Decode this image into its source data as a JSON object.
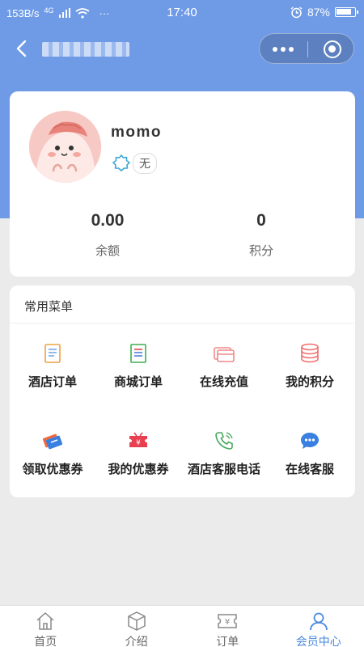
{
  "status_bar": {
    "speed": "153B/s",
    "network": "4G",
    "more": "···",
    "time": "17:40",
    "battery": "87%"
  },
  "profile": {
    "username": "momo",
    "level": "无"
  },
  "stats": [
    {
      "value": "0.00",
      "label": "余额"
    },
    {
      "value": "0",
      "label": "积分"
    }
  ],
  "menu": {
    "title": "常用菜单",
    "items": [
      {
        "label": "酒店订单",
        "icon": "document-icon"
      },
      {
        "label": "商城订单",
        "icon": "order-list-icon"
      },
      {
        "label": "在线充值",
        "icon": "card-icon"
      },
      {
        "label": "我的积分",
        "icon": "coins-icon"
      },
      {
        "label": "领取优惠券",
        "icon": "ticket-icon"
      },
      {
        "label": "我的优惠券",
        "icon": "coupon-icon"
      },
      {
        "label": "酒店客服电话",
        "icon": "phone-icon"
      },
      {
        "label": "在线客服",
        "icon": "chat-bubble-icon"
      }
    ]
  },
  "tabbar": [
    {
      "label": "首页",
      "icon": "home-icon"
    },
    {
      "label": "介绍",
      "icon": "box-icon"
    },
    {
      "label": "订单",
      "icon": "ticket-icon"
    },
    {
      "label": "会员中心",
      "icon": "user-icon",
      "active": true
    }
  ],
  "colors": {
    "header": "#6f9be6",
    "accent": "#4a8ae0",
    "background": "#ebebeb"
  }
}
